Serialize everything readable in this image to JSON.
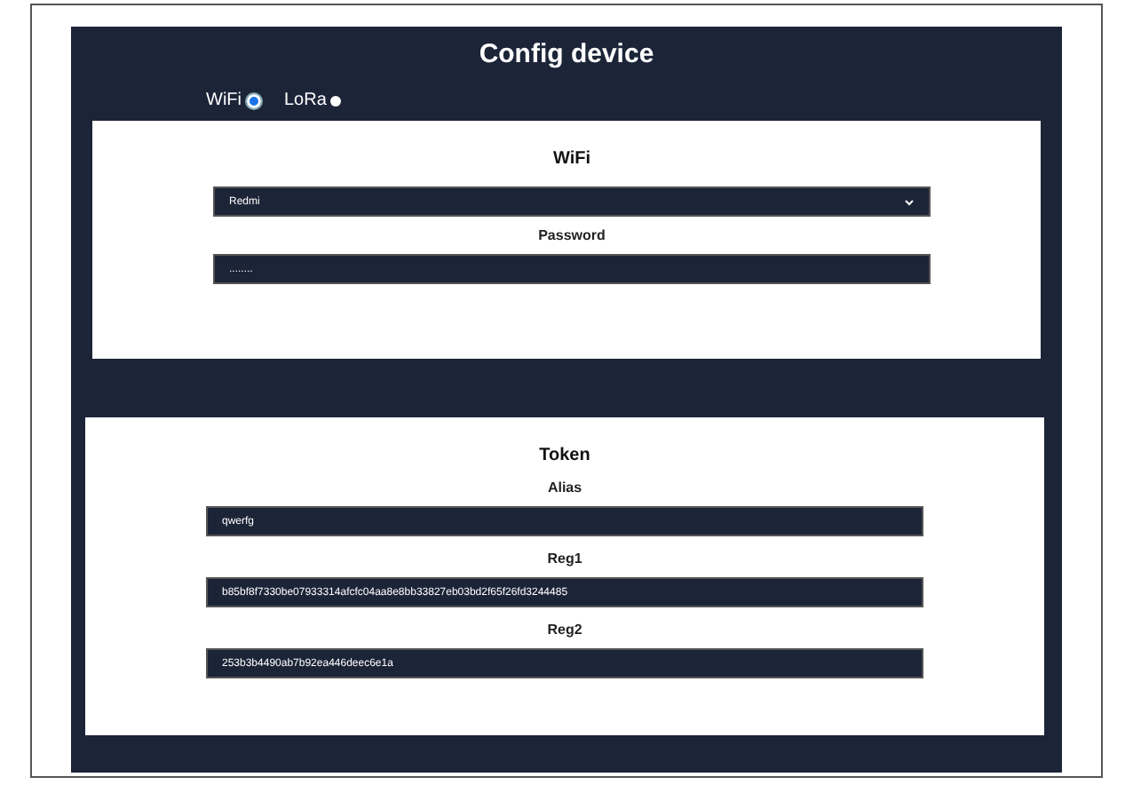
{
  "title": "Config device",
  "modes": [
    {
      "label": "WiFi",
      "selected": true
    },
    {
      "label": "LoRa",
      "selected": false
    }
  ],
  "wifi": {
    "title": "WiFi",
    "network": {
      "value": "Redmi"
    },
    "password": {
      "label": "Password",
      "value": "........"
    }
  },
  "token": {
    "title": "Token",
    "fields": [
      {
        "label": "Alias",
        "value": "qwerfg"
      },
      {
        "label": "Reg1",
        "value": "b85bf8f7330be07933314afcfc04aa8e8bb33827eb03bd2f65f26fd3244485"
      },
      {
        "label": "Reg2",
        "value": "253b3b4490ab7b92ea446deec6e1a"
      }
    ]
  }
}
